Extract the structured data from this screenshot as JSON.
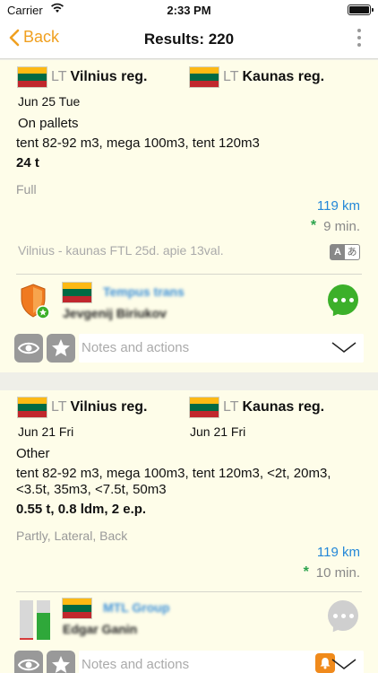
{
  "status": {
    "carrier": "Carrier",
    "time": "2:33 PM"
  },
  "nav": {
    "back_label": "Back",
    "title": "Results: 220"
  },
  "colors": {
    "accent": "#f0a020",
    "link_blue": "#2488d8",
    "green": "#2da44e",
    "card_bg": "#fefde9"
  },
  "loads": [
    {
      "from": {
        "country": "LT",
        "region": "Vilnius reg.",
        "date": "Jun 25 Tue"
      },
      "to": {
        "country": "LT",
        "region": "Kaunas reg."
      },
      "cargo": "On pallets",
      "trucks": "tent 82-92 m3, mega 100m3, tent 120m3",
      "weight": "24 t",
      "load_type": "Full",
      "distance": "119 km",
      "posted": "9 min.",
      "note": "Vilnius - kaunas  FTL 25d. apie 13val.",
      "company": {
        "name": "Tempus trans",
        "contact": "Jevgenij Biriukov",
        "badge_icon": "shield-icon"
      },
      "chat_active": true,
      "notes_placeholder": "Notes and actions"
    },
    {
      "from": {
        "country": "LT",
        "region": "Vilnius reg.",
        "date": "Jun 21 Fri"
      },
      "to": {
        "country": "LT",
        "region": "Kaunas reg.",
        "date": "Jun 21 Fri"
      },
      "cargo": "Other",
      "trucks": "tent 82-92 m3, mega 100m3, tent 120m3, <2t, 20m3,",
      "trucks_line2": "<3.5t, 35m3, <7.5t, 50m3",
      "weight": "0.55 t, 0.8 ldm, 2 e.p.",
      "load_type": "Partly, Lateral, Back",
      "distance": "119 km",
      "posted": "10 min.",
      "company": {
        "name": "MTL Group",
        "contact": "Edgar Ganin",
        "badge_icon": "rating-bars-icon"
      },
      "chat_active": false,
      "notes_placeholder": "Notes and actions"
    }
  ]
}
